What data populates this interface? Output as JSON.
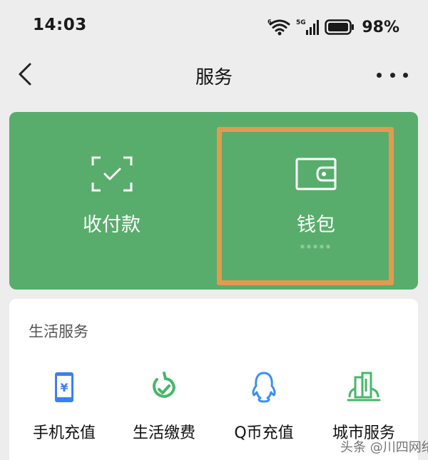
{
  "status_bar": {
    "time": "14:03",
    "battery_percent": "98%",
    "network_label": "5G",
    "wifi_badge": "6"
  },
  "nav": {
    "title": "服务",
    "back_icon": "chevron-left-icon",
    "more_icon": "more-dots-icon"
  },
  "wallet_card": {
    "background_color": "#58ad6c",
    "highlight_color": "#e39a4f",
    "left": {
      "label": "收付款",
      "icon": "scan-check-icon"
    },
    "right": {
      "label": "钱包",
      "masked_balance": "*****",
      "icon": "wallet-icon"
    }
  },
  "services": {
    "title": "生活服务",
    "items": [
      {
        "label": "手机充值",
        "icon": "phone-recharge-icon",
        "color": "#3d7ff0"
      },
      {
        "label": "生活缴费",
        "icon": "utility-payment-icon",
        "color": "#49b66b"
      },
      {
        "label": "Q币充值",
        "icon": "qq-coin-icon",
        "color": "#3d8ff0"
      },
      {
        "label": "城市服务",
        "icon": "city-service-icon",
        "color": "#49b66b"
      }
    ]
  },
  "watermark": {
    "text": "头条 @川四网络"
  }
}
